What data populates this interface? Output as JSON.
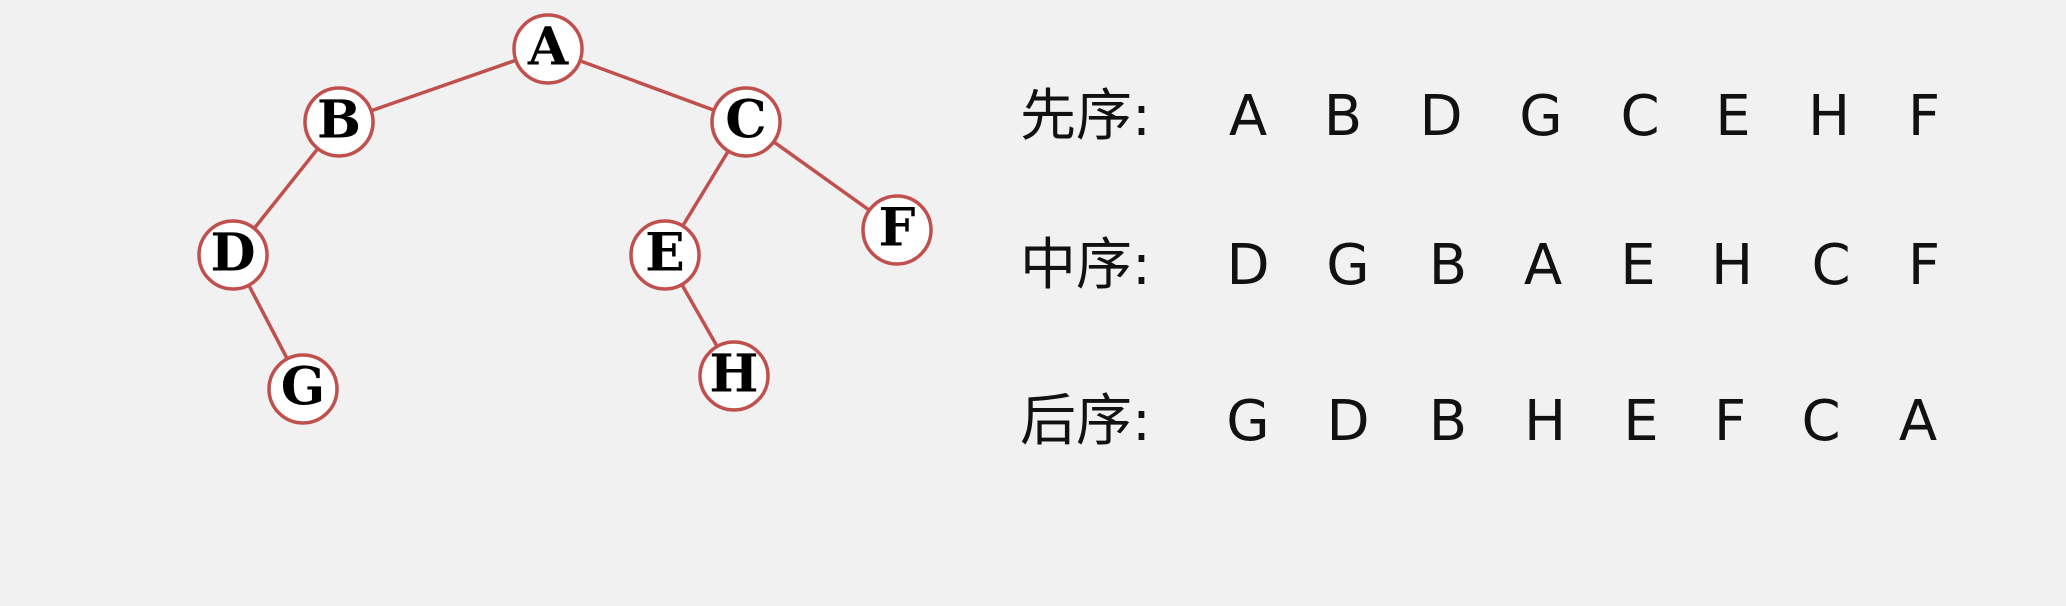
{
  "tree": {
    "colors": {
      "edge": "#c0504d",
      "node_border": "#c0504d",
      "node_fill": "#ffffff",
      "label": "#000000"
    },
    "nodes": [
      {
        "id": "A",
        "label": "A"
      },
      {
        "id": "B",
        "label": "B"
      },
      {
        "id": "C",
        "label": "C"
      },
      {
        "id": "D",
        "label": "D"
      },
      {
        "id": "E",
        "label": "E"
      },
      {
        "id": "F",
        "label": "F"
      },
      {
        "id": "G",
        "label": "G"
      },
      {
        "id": "H",
        "label": "H"
      }
    ],
    "edges": [
      {
        "from": "A",
        "to": "B"
      },
      {
        "from": "A",
        "to": "C"
      },
      {
        "from": "B",
        "to": "D"
      },
      {
        "from": "D",
        "to": "G"
      },
      {
        "from": "C",
        "to": "E"
      },
      {
        "from": "C",
        "to": "F"
      },
      {
        "from": "E",
        "to": "H"
      }
    ]
  },
  "traversals": [
    {
      "label": "先序:",
      "sequence": [
        "A",
        "B",
        "D",
        "G",
        "C",
        "E",
        "H",
        "F"
      ]
    },
    {
      "label": "中序:",
      "sequence": [
        "D",
        "G",
        "B",
        "A",
        "E",
        "H",
        "C",
        "F"
      ]
    },
    {
      "label": "后序:",
      "sequence": [
        "G",
        "D",
        "B",
        "H",
        "E",
        "F",
        "C",
        "A"
      ]
    }
  ]
}
